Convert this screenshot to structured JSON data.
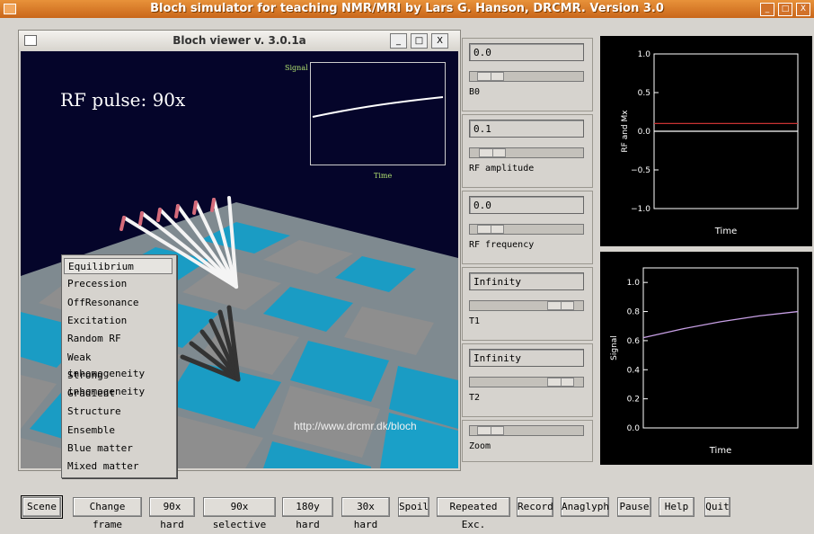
{
  "app": {
    "title": "Bloch simulator for teaching NMR/MRI by Lars G. Hanson, DRCMR. Version 3.0",
    "minimize": "_",
    "maximize": "□",
    "close": "X"
  },
  "viewer": {
    "title": "Bloch viewer v. 3.0.1a",
    "minimize": "_",
    "maximize": "□",
    "close": "X",
    "caption": "RF pulse: 90x",
    "url": "http://www.drcmr.dk/bloch",
    "inset_ylabel": "Signal",
    "inset_xlabel": "Time"
  },
  "menu": {
    "items": [
      "Equilibrium",
      "Precession",
      "OffResonance",
      "Excitation",
      "Random RF",
      "Weak inhomogeneity",
      "Strong inhomogeneity",
      "Gradient",
      "Structure",
      "Ensemble",
      "Blue matter",
      "Mixed matter"
    ],
    "selected": "Equilibrium"
  },
  "controls": [
    {
      "label": "B0",
      "value": "0.0",
      "level": 0.08
    },
    {
      "label": "RF amplitude",
      "value": "0.1",
      "level": 0.1
    },
    {
      "label": "RF frequency",
      "value": "0.0",
      "level": 0.08
    },
    {
      "label": "T1",
      "value": "Infinity",
      "level": 0.9
    },
    {
      "label": "T2",
      "value": "Infinity",
      "level": 0.9
    },
    {
      "label": "Zoom",
      "value": "",
      "level": 0.08
    }
  ],
  "chart_data": [
    {
      "type": "line",
      "xlabel": "Time",
      "ylabel": "RF and Mx",
      "ylim": [
        -1.0,
        1.0
      ],
      "yticks": [
        "1.0",
        "0.5",
        "0.0",
        "−0.5",
        "−1.0"
      ],
      "series": [
        {
          "color": "#c83232",
          "x": [
            0,
            1
          ],
          "y": [
            0.1,
            0.1
          ]
        },
        {
          "color": "#ffffff",
          "x": [
            0,
            1
          ],
          "y": [
            0.0,
            0.0
          ]
        }
      ]
    },
    {
      "type": "line",
      "xlabel": "Time",
      "ylabel": "Signal",
      "ylim": [
        0.0,
        1.1
      ],
      "yticks": [
        "1.0",
        "0.8",
        "0.6",
        "0.4",
        "0.2",
        "0.0"
      ],
      "series": [
        {
          "color": "#c8a0e6",
          "x": [
            0,
            0.25,
            0.5,
            0.75,
            1.0
          ],
          "y": [
            0.62,
            0.68,
            0.73,
            0.77,
            0.8
          ]
        }
      ]
    }
  ],
  "buttons": [
    "Scene",
    "Change frame",
    "90x hard",
    "90x selective",
    "180y hard",
    "30x hard",
    "Spoil",
    "Repeated Exc.",
    "Record",
    "Anaglyph",
    "Pause",
    "Help",
    "Quit"
  ],
  "colors": {
    "title_orange": "#d2722a",
    "floor_blue": "#1aa0c8",
    "floor_gray": "#8a8a8a"
  }
}
